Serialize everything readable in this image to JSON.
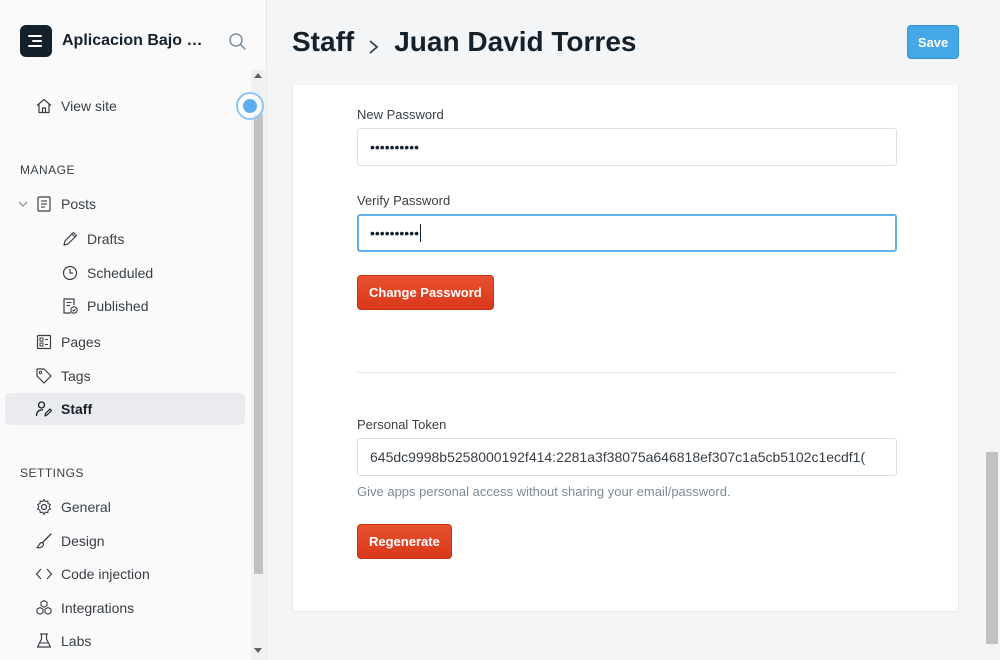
{
  "app": {
    "title": "Aplicacion Bajo Pr..."
  },
  "sidebar": {
    "view_site": "View site",
    "manage_heading": "MANAGE",
    "settings_heading": "SETTINGS",
    "posts": "Posts",
    "drafts": "Drafts",
    "scheduled": "Scheduled",
    "published": "Published",
    "pages": "Pages",
    "tags": "Tags",
    "staff": "Staff",
    "general": "General",
    "design": "Design",
    "code_injection": "Code injection",
    "integrations": "Integrations",
    "labs": "Labs"
  },
  "header": {
    "section": "Staff",
    "user_name": "Juan David Torres",
    "save_label": "Save"
  },
  "form": {
    "new_password_label": "New Password",
    "new_password_value": "••••••••••",
    "verify_password_label": "Verify Password",
    "verify_password_value": "••••••••••",
    "change_password_label": "Change Password",
    "personal_token_label": "Personal Token",
    "personal_token_value": "645dc9998b5258000192f414:2281a3f38075a646818ef307c1a5cb5102c1ecdf1(",
    "token_help": "Give apps personal access without sharing your email/password.",
    "regenerate_label": "Regenerate"
  },
  "colors": {
    "accent_blue": "#45a7e6",
    "danger_red": "#e03a1c",
    "sidebar_bg": "#fafafb",
    "page_bg": "#f4f5f6"
  }
}
